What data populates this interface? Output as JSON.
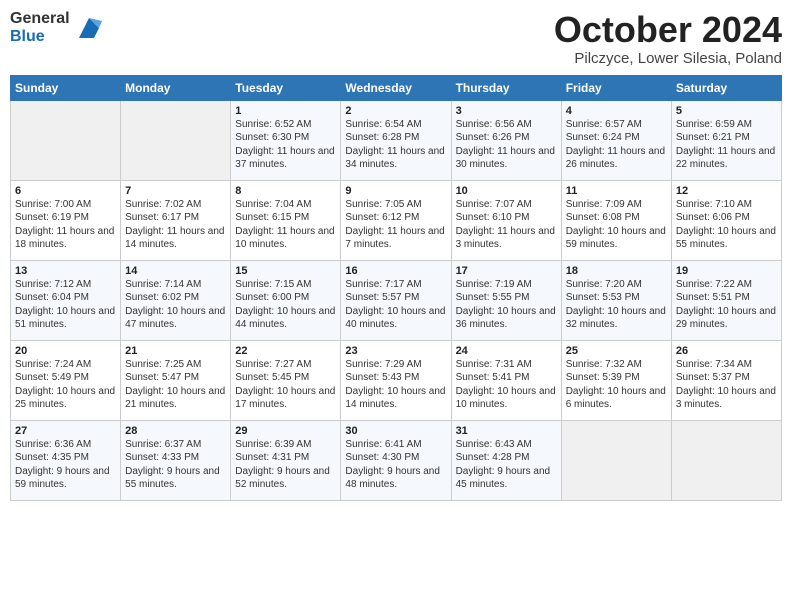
{
  "header": {
    "logo_general": "General",
    "logo_blue": "Blue",
    "month_title": "October 2024",
    "subtitle": "Pilczyce, Lower Silesia, Poland"
  },
  "days_of_week": [
    "Sunday",
    "Monday",
    "Tuesday",
    "Wednesday",
    "Thursday",
    "Friday",
    "Saturday"
  ],
  "weeks": [
    [
      {
        "day": "",
        "info": ""
      },
      {
        "day": "",
        "info": ""
      },
      {
        "day": "1",
        "info": "Sunrise: 6:52 AM\nSunset: 6:30 PM\nDaylight: 11 hours\nand 37 minutes."
      },
      {
        "day": "2",
        "info": "Sunrise: 6:54 AM\nSunset: 6:28 PM\nDaylight: 11 hours\nand 34 minutes."
      },
      {
        "day": "3",
        "info": "Sunrise: 6:56 AM\nSunset: 6:26 PM\nDaylight: 11 hours\nand 30 minutes."
      },
      {
        "day": "4",
        "info": "Sunrise: 6:57 AM\nSunset: 6:24 PM\nDaylight: 11 hours\nand 26 minutes."
      },
      {
        "day": "5",
        "info": "Sunrise: 6:59 AM\nSunset: 6:21 PM\nDaylight: 11 hours\nand 22 minutes."
      }
    ],
    [
      {
        "day": "6",
        "info": "Sunrise: 7:00 AM\nSunset: 6:19 PM\nDaylight: 11 hours\nand 18 minutes."
      },
      {
        "day": "7",
        "info": "Sunrise: 7:02 AM\nSunset: 6:17 PM\nDaylight: 11 hours\nand 14 minutes."
      },
      {
        "day": "8",
        "info": "Sunrise: 7:04 AM\nSunset: 6:15 PM\nDaylight: 11 hours\nand 10 minutes."
      },
      {
        "day": "9",
        "info": "Sunrise: 7:05 AM\nSunset: 6:12 PM\nDaylight: 11 hours\nand 7 minutes."
      },
      {
        "day": "10",
        "info": "Sunrise: 7:07 AM\nSunset: 6:10 PM\nDaylight: 11 hours\nand 3 minutes."
      },
      {
        "day": "11",
        "info": "Sunrise: 7:09 AM\nSunset: 6:08 PM\nDaylight: 10 hours\nand 59 minutes."
      },
      {
        "day": "12",
        "info": "Sunrise: 7:10 AM\nSunset: 6:06 PM\nDaylight: 10 hours\nand 55 minutes."
      }
    ],
    [
      {
        "day": "13",
        "info": "Sunrise: 7:12 AM\nSunset: 6:04 PM\nDaylight: 10 hours\nand 51 minutes."
      },
      {
        "day": "14",
        "info": "Sunrise: 7:14 AM\nSunset: 6:02 PM\nDaylight: 10 hours\nand 47 minutes."
      },
      {
        "day": "15",
        "info": "Sunrise: 7:15 AM\nSunset: 6:00 PM\nDaylight: 10 hours\nand 44 minutes."
      },
      {
        "day": "16",
        "info": "Sunrise: 7:17 AM\nSunset: 5:57 PM\nDaylight: 10 hours\nand 40 minutes."
      },
      {
        "day": "17",
        "info": "Sunrise: 7:19 AM\nSunset: 5:55 PM\nDaylight: 10 hours\nand 36 minutes."
      },
      {
        "day": "18",
        "info": "Sunrise: 7:20 AM\nSunset: 5:53 PM\nDaylight: 10 hours\nand 32 minutes."
      },
      {
        "day": "19",
        "info": "Sunrise: 7:22 AM\nSunset: 5:51 PM\nDaylight: 10 hours\nand 29 minutes."
      }
    ],
    [
      {
        "day": "20",
        "info": "Sunrise: 7:24 AM\nSunset: 5:49 PM\nDaylight: 10 hours\nand 25 minutes."
      },
      {
        "day": "21",
        "info": "Sunrise: 7:25 AM\nSunset: 5:47 PM\nDaylight: 10 hours\nand 21 minutes."
      },
      {
        "day": "22",
        "info": "Sunrise: 7:27 AM\nSunset: 5:45 PM\nDaylight: 10 hours\nand 17 minutes."
      },
      {
        "day": "23",
        "info": "Sunrise: 7:29 AM\nSunset: 5:43 PM\nDaylight: 10 hours\nand 14 minutes."
      },
      {
        "day": "24",
        "info": "Sunrise: 7:31 AM\nSunset: 5:41 PM\nDaylight: 10 hours\nand 10 minutes."
      },
      {
        "day": "25",
        "info": "Sunrise: 7:32 AM\nSunset: 5:39 PM\nDaylight: 10 hours\nand 6 minutes."
      },
      {
        "day": "26",
        "info": "Sunrise: 7:34 AM\nSunset: 5:37 PM\nDaylight: 10 hours\nand 3 minutes."
      }
    ],
    [
      {
        "day": "27",
        "info": "Sunrise: 6:36 AM\nSunset: 4:35 PM\nDaylight: 9 hours\nand 59 minutes."
      },
      {
        "day": "28",
        "info": "Sunrise: 6:37 AM\nSunset: 4:33 PM\nDaylight: 9 hours\nand 55 minutes."
      },
      {
        "day": "29",
        "info": "Sunrise: 6:39 AM\nSunset: 4:31 PM\nDaylight: 9 hours\nand 52 minutes."
      },
      {
        "day": "30",
        "info": "Sunrise: 6:41 AM\nSunset: 4:30 PM\nDaylight: 9 hours\nand 48 minutes."
      },
      {
        "day": "31",
        "info": "Sunrise: 6:43 AM\nSunset: 4:28 PM\nDaylight: 9 hours\nand 45 minutes."
      },
      {
        "day": "",
        "info": ""
      },
      {
        "day": "",
        "info": ""
      }
    ]
  ]
}
